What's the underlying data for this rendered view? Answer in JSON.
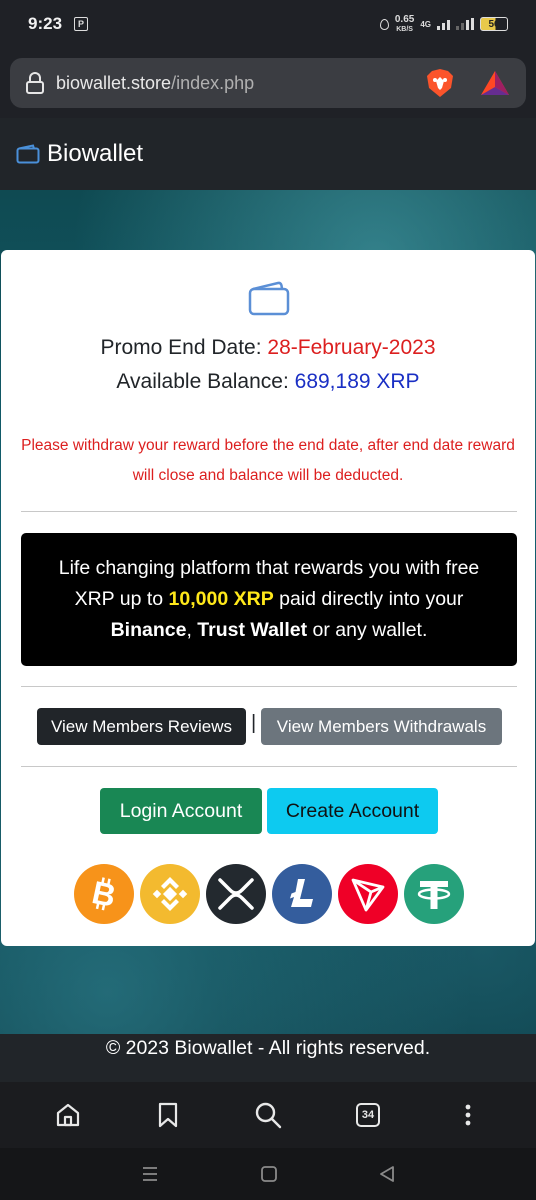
{
  "status_bar": {
    "time": "9:23",
    "notification_badge": "P",
    "net_speed_value": "0.65",
    "net_speed_unit": "KB/S",
    "network_type": "4G",
    "battery_level": "56"
  },
  "browser": {
    "url_domain": "biowallet.store",
    "url_path": "/index.php",
    "tab_count": "34"
  },
  "navbar": {
    "brand": "Biowallet"
  },
  "card": {
    "promo_label": "Promo End Date: ",
    "promo_date": "28-February-2023",
    "balance_label": "Available Balance: ",
    "balance_value": "689,189 XRP",
    "warning": "Please withdraw your reward before the end date, after end date reward will close and balance will be deducted.",
    "promo_text_1": "Life changing platform that rewards you with free XRP up to ",
    "promo_highlight": "10,000 XRP",
    "promo_text_2": " paid directly into your ",
    "promo_binance": "Binance",
    "promo_comma": ", ",
    "promo_trust": "Trust Wallet",
    "promo_text_3": " or any wallet.",
    "reviews_button": "View Members Reviews",
    "separator": "|",
    "withdrawals_button": "View Members Withdrawals",
    "login_button": "Login Account",
    "create_button": "Create Account",
    "coins": [
      "bitcoin-icon",
      "binance-coin-icon",
      "xrp-icon",
      "litecoin-icon",
      "tron-icon",
      "tether-icon"
    ]
  },
  "footer": {
    "text": "© 2023 Biowallet - All rights reserved."
  },
  "colors": {
    "accent_red": "#dc1f1f",
    "accent_blue": "#1a2fc4",
    "highlight_yellow": "#ffe81a",
    "login_green": "#198754",
    "create_cyan": "#0dcaf0"
  }
}
